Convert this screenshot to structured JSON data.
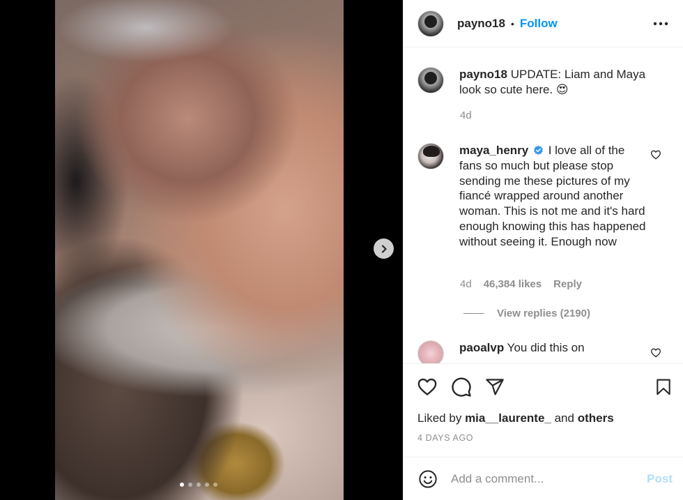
{
  "post": {
    "author": "payno18",
    "follow_label": "Follow",
    "caption_username": "payno18",
    "caption_text": "UPDATE: Liam and Maya look so cute here. 😍",
    "caption_age": "4d",
    "carousel": {
      "total_slides": 5,
      "active_index": 0
    }
  },
  "comments": [
    {
      "username": "maya_henry",
      "verified": true,
      "text": "I love all of the fans so much but please stop sending me these pictures of my fiancé wrapped around another woman. This is not me and it's hard enough knowing this has happened without seeing it. Enough now",
      "age": "4d",
      "likes": "46,384 likes",
      "reply_label": "Reply",
      "view_replies": "View replies (2190)"
    },
    {
      "username": "paoalvp",
      "verified": false,
      "text": "You did this on"
    }
  ],
  "actions": {
    "liked_by_prefix": "Liked by",
    "liked_by_user": "mia__laurente_",
    "liked_by_and": "and",
    "liked_by_others": "others",
    "date": "4 DAYS AGO"
  },
  "add_comment": {
    "placeholder": "Add a comment...",
    "post_label": "Post"
  },
  "icons": {
    "header": [
      "avatar",
      "more-options-icon"
    ],
    "actions": [
      "heart-icon",
      "comment-icon",
      "share-icon",
      "bookmark-icon"
    ],
    "carousel": [
      "chevron-right-icon"
    ],
    "input": [
      "emoji-icon"
    ]
  },
  "colors": {
    "accent": "#0095f6",
    "post_disabled": "#b2dffc",
    "secondary_text": "#8e8e8e",
    "verified_badge": "#3897f0"
  }
}
